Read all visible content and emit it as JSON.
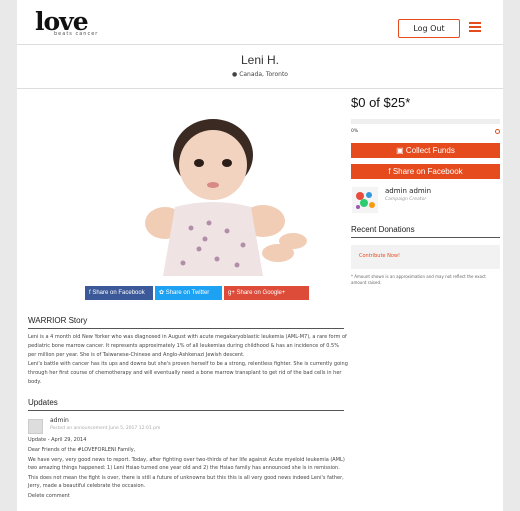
{
  "header": {
    "logo_text": "love",
    "logo_sub": "beats cancer",
    "logout_label": "Log Out"
  },
  "profile": {
    "name": "Leni H.",
    "location": "Canada, Toronto"
  },
  "share": {
    "facebook": "f Share on Facebook",
    "twitter": "Share on Twitter",
    "google": "g+ Share on Google+"
  },
  "story": {
    "title": "WARRIOR Story",
    "paragraphs": [
      "Leni is a 4 month old New Yorker who was diagnosed in August with acute megakaryoblastic leukemia (AML-M7), a rare form of pediatric bone marrow cancer. It represents approximately 1% of all leukemias during childhood & has an incidence of 0.5% per million per year. She is of Taiwanese-Chinese and Anglo-Ashkenazi Jewish descent.",
      "Leni's battle with cancer has its ups and downs but she's proven herself to be a strong, relentless fighter. She is currently going through her first course of chemotherapy and will eventually need a bone marrow transplant to get rid of the bad cells in her body."
    ]
  },
  "updates": {
    "title": "Updates",
    "author": "admin",
    "meta": "Posted an announcement June 5, 2017 12:01 pm",
    "lines": [
      "Update - April 29, 2014",
      "Dear Friends of the #LOVEFORLENI Family,",
      "We have very, very good news to report. Today, after fighting over two-thirds of her life against Acute myeloid leukemia (AML) two amazing things happened: 1) Leni Hsiao turned one year old and 2) the Hsiao family has announced she is in remission.",
      "This does not mean the fight is over, there is still a future of unknowns but this this is all very good news indeed Leni's father, Jerry, made a beautiful celebrate the occasion.",
      "Delete comment"
    ]
  },
  "campaign": {
    "amount": "$0 of $25*",
    "progress_percent": 0,
    "percent_label": "0%",
    "collect_label": "Collect Funds",
    "share_fb_label": "Share on Facebook",
    "creator_name": "admin admin",
    "creator_role": "Campaign Creator",
    "recent_title": "Recent Donations",
    "contribute_label": "Contribute Now!",
    "disclaimer": "* Amount shown is an approximation and may not reflect the exact amount raised."
  },
  "colors": {
    "accent": "#e64b1e",
    "facebook": "#3b5998",
    "twitter": "#1da1f2",
    "google": "#dd4b39"
  }
}
